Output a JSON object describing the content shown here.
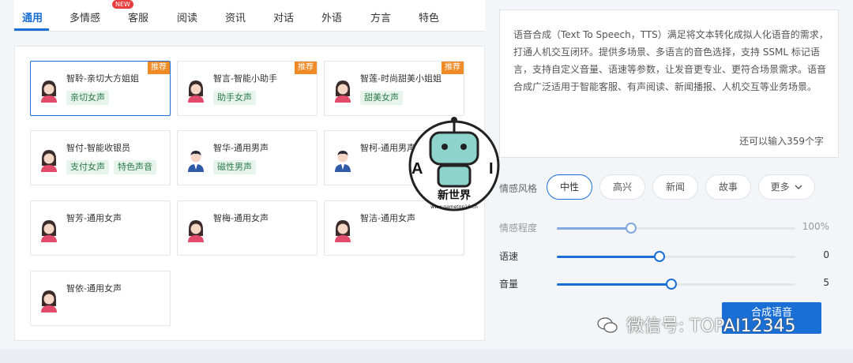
{
  "tabs": [
    {
      "label": "通用"
    },
    {
      "label": "多情感",
      "badge": "NEW"
    },
    {
      "label": "客服"
    },
    {
      "label": "阅读"
    },
    {
      "label": "资讯"
    },
    {
      "label": "对话"
    },
    {
      "label": "外语"
    },
    {
      "label": "方言"
    },
    {
      "label": "特色"
    }
  ],
  "voices": [
    {
      "name": "智聆-亲切大方姐姐",
      "tags": [
        "亲切女声"
      ],
      "badge": "推荐",
      "gender": "female",
      "selected": true
    },
    {
      "name": "智言-智能小助手",
      "tags": [
        "助手女声"
      ],
      "badge": "推荐",
      "gender": "female"
    },
    {
      "name": "智莲-时尚甜美小姐姐",
      "tags": [
        "甜美女声"
      ],
      "badge": "推荐",
      "gender": "female"
    },
    {
      "name": "智付-智能收银员",
      "tags": [
        "支付女声",
        "特色声音"
      ],
      "gender": "female"
    },
    {
      "name": "智华-通用男声",
      "tags": [
        "磁性男声"
      ],
      "gender": "male"
    },
    {
      "name": "智柯-通用男声",
      "tags": [],
      "gender": "male"
    },
    {
      "name": "智芳-通用女声",
      "tags": [],
      "gender": "female"
    },
    {
      "name": "智梅-通用女声",
      "tags": [],
      "gender": "female"
    },
    {
      "name": "智洁-通用女声",
      "tags": [],
      "gender": "female"
    },
    {
      "name": "智依-通用女声",
      "tags": [],
      "gender": "female"
    }
  ],
  "description": {
    "text": "语音合成（Text To Speech，TTS）满足将文本转化成拟人化语音的需求，打通人机交互闭环。提供多场景、多语言的音色选择，支持 SSML 标记语言，支持自定义音量、语速等参数，让发音更专业、更符合场景需求。语音合成广泛适用于智能客服、有声阅读、新闻播报、人机交互等业务场景。",
    "remaining": "还可以输入359个字"
  },
  "emotion_style": {
    "label": "情感风格",
    "options": [
      "中性",
      "高兴",
      "新闻",
      "故事",
      "更多"
    ],
    "selected": "中性"
  },
  "sliders": [
    {
      "id": "emotion-level",
      "label": "情感程度",
      "value_text": "100%",
      "fraction": 0.31,
      "muted": true
    },
    {
      "id": "speed",
      "label": "语速",
      "value_text": "0",
      "fraction": 0.43
    },
    {
      "id": "volume",
      "label": "音量",
      "value_text": "5",
      "fraction": 0.48
    }
  ],
  "synthesize_label": "合成语音",
  "watermark": {
    "text": "微信号: TOPAI12345",
    "logo_text": "新世界",
    "logo_url_text": "www.gametop10.cn",
    "logo_letters": [
      "A",
      "I"
    ]
  },
  "colors": {
    "accent": "#1a6fd6",
    "recommend_badge": "#f08a24",
    "tag_bg": "#e6f4ec",
    "tag_text": "#2f7a4c"
  },
  "icons": {
    "avatar_female": "female-avatar-icon",
    "avatar_male": "male-avatar-icon",
    "dropdown": "chevron-down-icon",
    "wechat": "wechat-icon"
  }
}
